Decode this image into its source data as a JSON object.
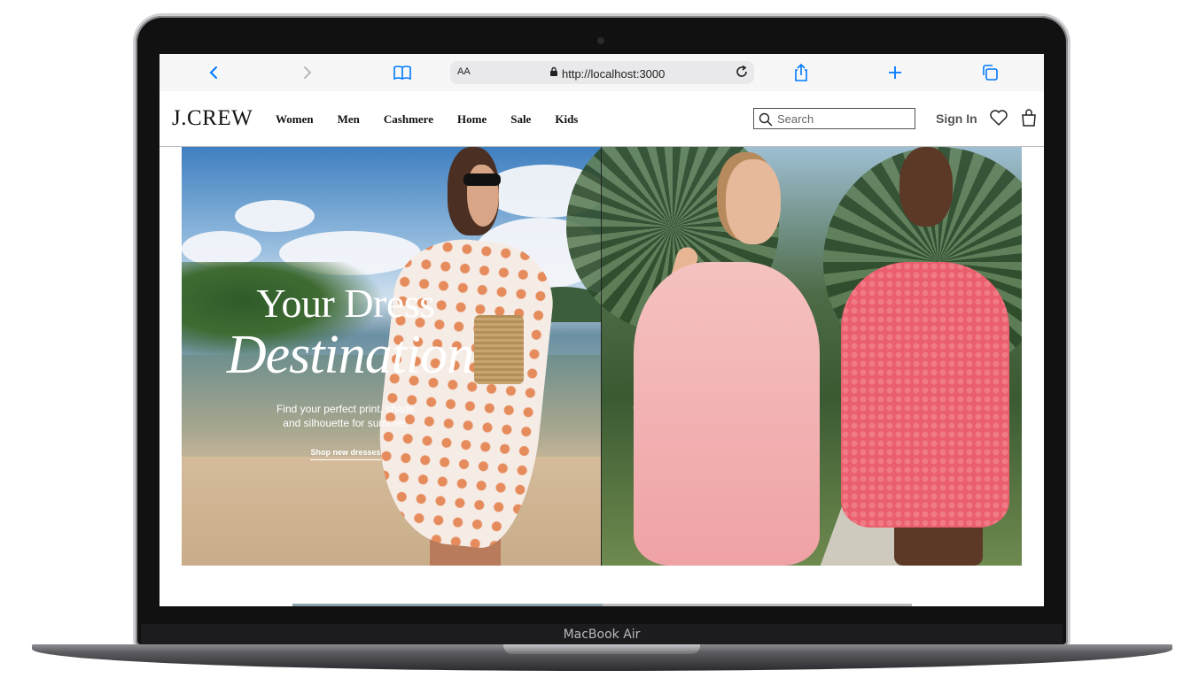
{
  "device": {
    "label": "MacBook Air"
  },
  "browser": {
    "aa_label": "AA",
    "url": "http://localhost:3000",
    "icons": [
      "back-chevron-icon",
      "forward-chevron-icon",
      "book-icon",
      "lock-icon",
      "reload-icon",
      "share-icon",
      "plus-icon",
      "tabs-icon"
    ],
    "accent_color": "#007aff"
  },
  "site": {
    "logo": "J.CREW",
    "nav": [
      "Women",
      "Men",
      "Cashmere",
      "Home",
      "Sale",
      "Kids"
    ],
    "search": {
      "placeholder": "Search",
      "value": ""
    },
    "sign_in": "Sign In"
  },
  "hero": {
    "title_line1": "Your Dress",
    "title_line2": "Destination",
    "subtitle_line1": "Find your perfect print, shade",
    "subtitle_line2": "and silhouette for summer.",
    "cta": "Shop new dresses"
  }
}
